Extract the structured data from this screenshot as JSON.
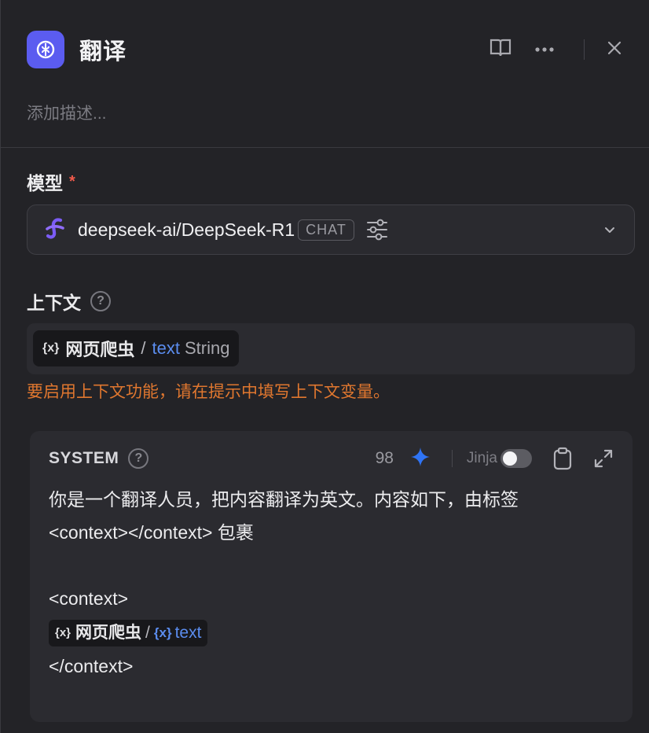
{
  "header": {
    "title": "翻译",
    "app_icon": "llm-node-icon",
    "actions": [
      "book-icon",
      "more-icon",
      "close-icon"
    ]
  },
  "description": {
    "placeholder": "添加描述..."
  },
  "model": {
    "label": "模型",
    "required_mark": "*",
    "name": "deepseek-ai/DeepSeek-R1",
    "tag": "CHAT",
    "icon": "deepseek-logo-icon"
  },
  "context": {
    "label": "上下文",
    "variable": {
      "x_symbol": "{x}",
      "node": "网页爬虫",
      "separator": "/",
      "name": "text",
      "type": "String"
    },
    "warning": "要启用上下文功能，请在提示中填写上下文变量。"
  },
  "system": {
    "label": "SYSTEM",
    "token_count": "98",
    "jinja_label": "Jinja",
    "jinja_enabled": false,
    "lines": [
      "你是一个翻译人员，把内容翻译为英文。内容如下，由标签",
      "<context></context> 包裹",
      "<context>",
      "</context>"
    ],
    "inline_var": {
      "x_symbol": "{x}",
      "node": "网页爬虫",
      "separator": "/",
      "var_symbol": "{x}",
      "name": "text"
    }
  },
  "colors": {
    "accent": "#5b5cf0",
    "variable": "#5b8def",
    "warning": "#e0772f",
    "required": "#f05a4b"
  }
}
